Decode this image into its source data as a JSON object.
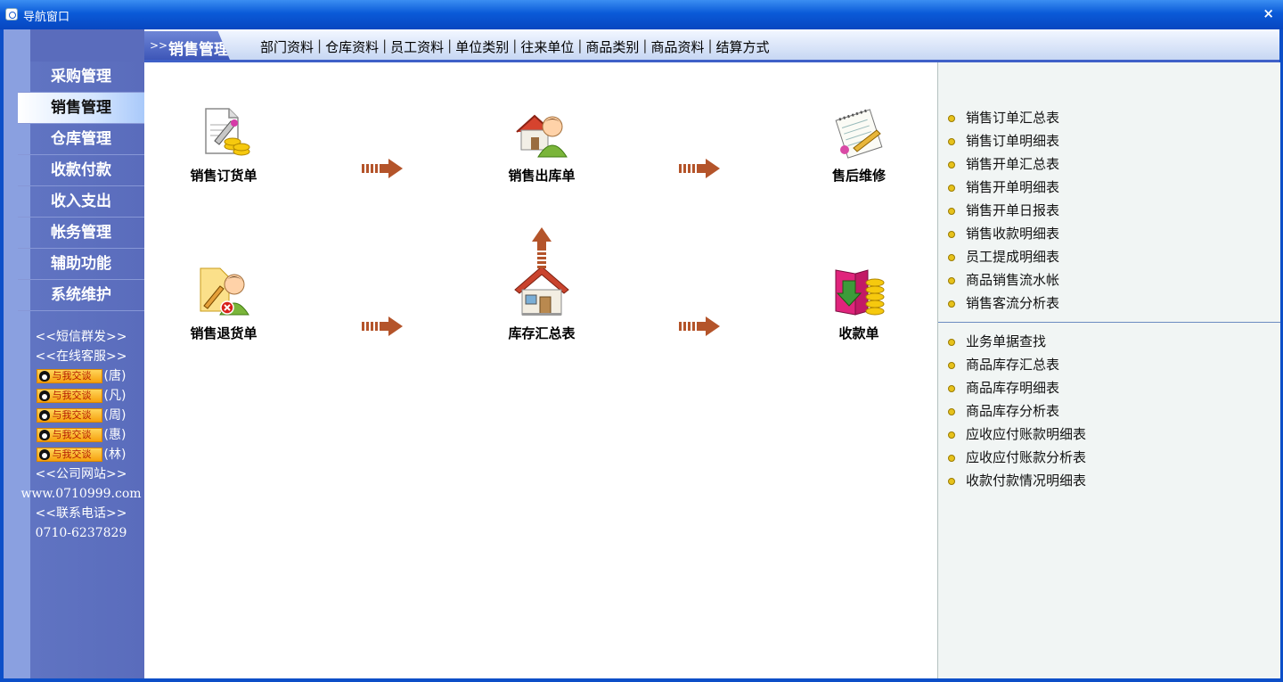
{
  "window": {
    "title": "导航窗口",
    "close_glyph": "×"
  },
  "sidebar": {
    "menu": [
      "采购管理",
      "销售管理",
      "仓库管理",
      "收款付款",
      "收入支出",
      "帐务管理",
      "辅助功能",
      "系统维护"
    ],
    "active_index": 1,
    "links": {
      "sms": "<<短信群发>>",
      "service": "<<在线客服>>",
      "qq_label": "与我交谈",
      "qq_contacts": [
        "(唐)",
        "(凡)",
        "(周)",
        "(惠)",
        "(林)"
      ],
      "site_title": "<<公司网站>>",
      "site_url": "www.0710999.com",
      "phone_title": "<<联系电话>>",
      "phone": "0710-6237829"
    }
  },
  "topbar": {
    "arrow": ">>",
    "section": "销售管理",
    "quicklinks": [
      "部门资料",
      "仓库资料",
      "员工资料",
      "单位类别",
      "往来单位",
      "商品类别",
      "商品资料",
      "结算方式"
    ],
    "separator": "|"
  },
  "flow": {
    "nodes": {
      "sales_order": {
        "label": "销售订货单",
        "icon": "document-coins-icon"
      },
      "sales_outbound": {
        "label": "销售出库单",
        "icon": "user-house-icon"
      },
      "after_sales": {
        "label": "售后维修",
        "icon": "notepad-icon"
      },
      "sales_return": {
        "label": "销售退货单",
        "icon": "user-return-icon"
      },
      "stock_summary": {
        "label": "库存汇总表",
        "icon": "house-icon"
      },
      "receipt": {
        "label": "收款单",
        "icon": "book-coins-icon"
      }
    }
  },
  "reports": {
    "group1": [
      "销售订单汇总表",
      "销售订单明细表",
      "销售开单汇总表",
      "销售开单明细表",
      "销售开单日报表",
      "销售收款明细表",
      "员工提成明细表",
      "商品销售流水帐",
      "销售客流分析表"
    ],
    "group2": [
      "业务单据查找",
      "商品库存汇总表",
      "商品库存明细表",
      "商品库存分析表",
      "应收应付账款明细表",
      "应收应付账款分析表",
      "收款付款情况明细表"
    ]
  },
  "colors": {
    "title_bar": "#0a5ad8",
    "sidebar": "#5a6cbc",
    "accent_arrow": "#b4542a",
    "panel_bg": "#f1f5f4"
  }
}
